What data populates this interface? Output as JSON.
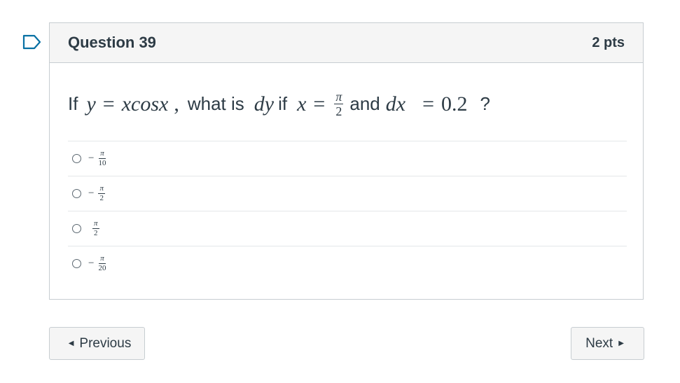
{
  "question": {
    "title": "Question 39",
    "points": "2 pts",
    "text": {
      "if": "If",
      "eq_lhs": "y",
      "eq_sign": "=",
      "eq_rhs": "xcosx",
      "comma": ",",
      "what_is": "what is",
      "dy": "dy",
      "if2": "if",
      "x": "x",
      "eq2": "=",
      "pi_num": "π",
      "pi_den": "2",
      "and": "and",
      "dx": "dx",
      "eq3": "=",
      "dx_value": "0.2",
      "qmark": "?"
    }
  },
  "answers": [
    {
      "sign": "−",
      "num": "π",
      "den": "10"
    },
    {
      "sign": "−",
      "num": "π",
      "den": "2"
    },
    {
      "sign": "",
      "num": "π",
      "den": "2"
    },
    {
      "sign": "−",
      "num": "π",
      "den": "20"
    }
  ],
  "nav": {
    "previous": "Previous",
    "next": "Next",
    "prev_arrow": "◀",
    "next_arrow": "▶"
  },
  "icons": {
    "flag": "bookmark-flag-icon"
  },
  "colors": {
    "text": "#2d3b45",
    "accent": "#0770a3",
    "border": "#c7cdd1",
    "header_bg": "#f5f5f5"
  }
}
